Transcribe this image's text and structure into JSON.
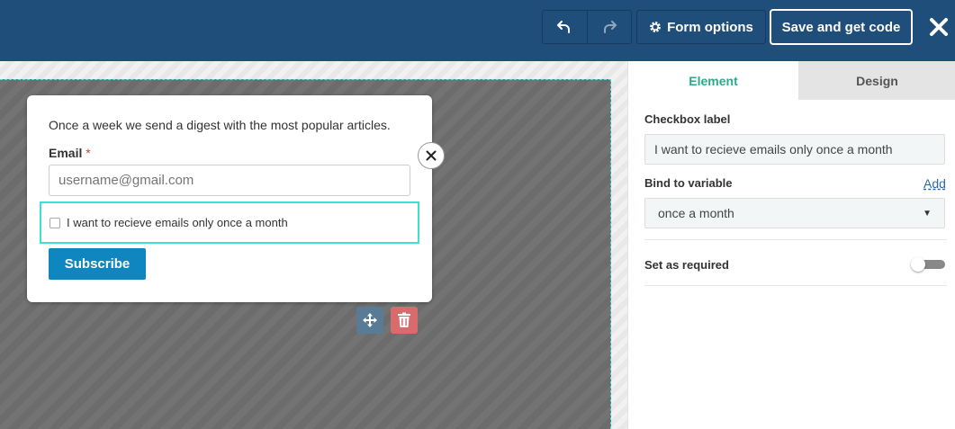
{
  "header": {
    "undo_icon": "undo-icon",
    "redo_icon": "redo-icon",
    "form_options_label": "Form options",
    "save_label": "Save and get code",
    "close_icon": "close-icon"
  },
  "form": {
    "description": "Once a week we send a digest with the most popular articles.",
    "email_label": "Email",
    "email_required_mark": "*",
    "email_placeholder": "username@gmail.com",
    "checkbox_label": "I want to recieve emails only once a month",
    "subscribe_label": "Subscribe"
  },
  "panel": {
    "tabs": [
      {
        "label": "Element",
        "active": true
      },
      {
        "label": "Design",
        "active": false
      }
    ],
    "checkbox_label_title": "Checkbox label",
    "checkbox_label_value": "I want to recieve emails only once a month",
    "bind_title": "Bind to variable",
    "add_link": "Add",
    "bind_value": "once a month",
    "required_title": "Set as required",
    "required_on": false
  },
  "colors": {
    "header_bg": "#1f4e7a",
    "accent_tab": "#2eaa8a",
    "subscribe_bg": "#0f86bf",
    "selection_outline": "#3ee0d2",
    "delete_bg": "#d86b6b",
    "move_bg": "#5a7b94"
  }
}
